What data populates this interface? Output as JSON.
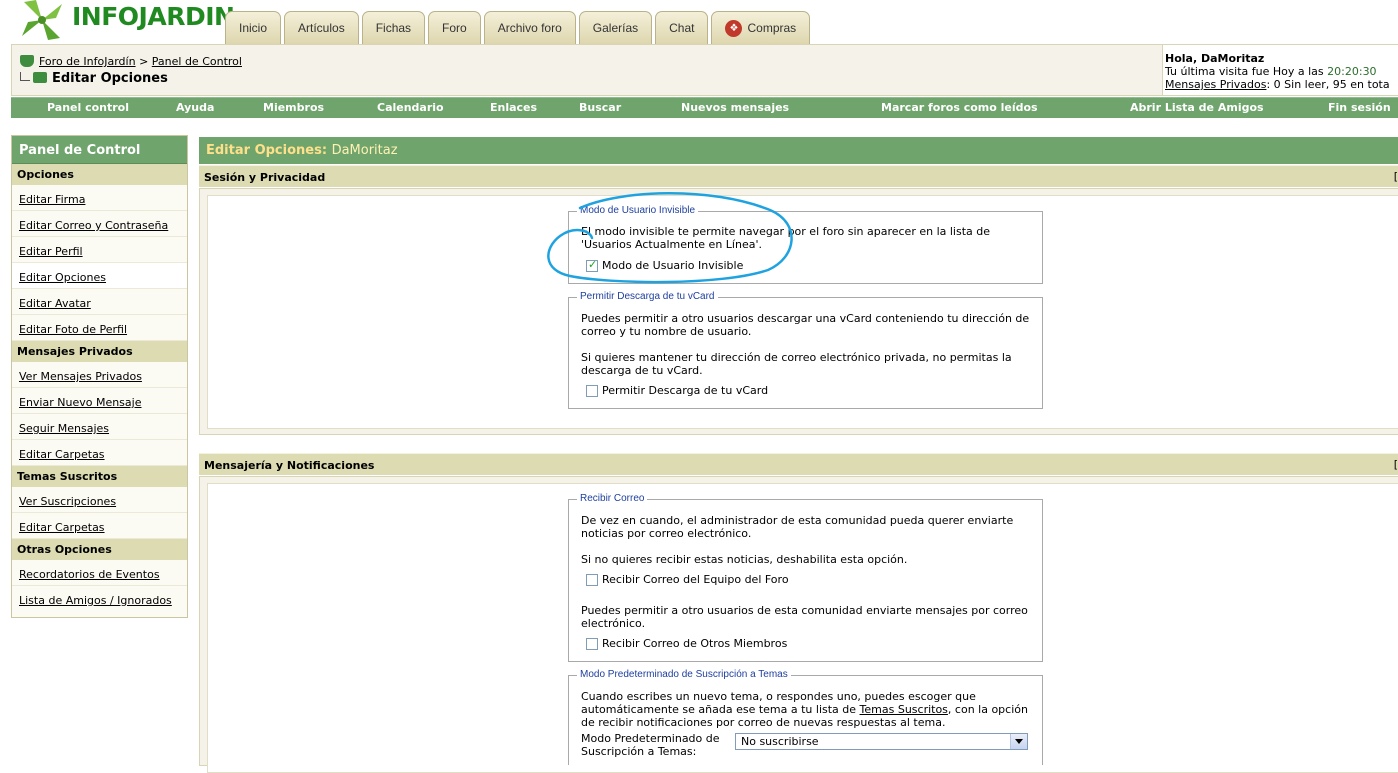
{
  "brand": {
    "logo_text": "INFOJARDIN"
  },
  "tabs": [
    {
      "label": "Inicio"
    },
    {
      "label": "Artículos"
    },
    {
      "label": "Fichas"
    },
    {
      "label": "Foro"
    },
    {
      "label": "Archivo foro"
    },
    {
      "label": "Galerías"
    },
    {
      "label": "Chat"
    },
    {
      "label": "Compras"
    }
  ],
  "breadcrumb": {
    "items": [
      "Foro de InfoJardín",
      "Panel de Control"
    ],
    "separator": ">",
    "current": "Editar Opciones"
  },
  "user": {
    "greeting": "Hola, DaMoritaz",
    "last_visit_prefix": "Tu última visita fue Hoy a las",
    "last_visit_time": "20:20:30",
    "pm_link": "Mensajes Privados",
    "pm_status": ": 0 Sin leer, 95 en tota"
  },
  "navbar": [
    "Panel control",
    "Ayuda",
    "Miembros",
    "Calendario",
    "Enlaces",
    "Buscar",
    "Nuevos mensajes",
    "Marcar foros como leídos",
    "Abrir Lista de Amigos",
    "Fin sesión"
  ],
  "sidebar": {
    "title": "Panel de Control",
    "sections": [
      {
        "title": "Opciones",
        "items": [
          "Editar Firma",
          "Editar Correo y Contraseña",
          "Editar Perfil",
          "Editar Opciones",
          "Editar Avatar",
          "Editar Foto de Perfil"
        ]
      },
      {
        "title": "Mensajes Privados",
        "items": [
          "Ver Mensajes Privados",
          "Enviar Nuevo Mensaje",
          "Seguir Mensajes",
          "Editar Carpetas"
        ]
      },
      {
        "title": "Temas Suscritos",
        "items": [
          "Ver Suscripciones",
          "Editar Carpetas"
        ]
      },
      {
        "title": "Otras Opciones",
        "items": [
          "Recordatorios de Eventos",
          "Lista de Amigos / Ignorados"
        ]
      }
    ],
    "active_item": "Editar Opciones"
  },
  "main": {
    "title": "Editar Opciones:",
    "username": "DaMoritaz",
    "section1": {
      "title": "Sesión y Privacidad",
      "toggle": "[",
      "invisible": {
        "legend": "Modo de Usuario Invisible",
        "description": "El modo invisible te permite navegar por el foro sin aparecer en la lista de 'Usuarios Actualmente en Línea'.",
        "checkbox_label": "Modo de Usuario Invisible",
        "checked": true
      },
      "vcard": {
        "legend": "Permitir Descarga de tu vCard",
        "description1": "Puedes permitir a otro usuarios descargar una vCard conteniendo tu dirección de correo y tu nombre de usuario.",
        "description2": "Si quieres mantener tu dirección de correo electrónico privada, no permitas la descarga de tu vCard.",
        "checkbox_label": "Permitir Descarga de tu vCard",
        "checked": false
      }
    },
    "section2": {
      "title": "Mensajería y Notificaciones",
      "toggle": "[",
      "email": {
        "legend": "Recibir Correo",
        "description1": "De vez en cuando, el administrador de esta comunidad pueda querer enviarte noticias por correo electrónico.",
        "description2": "Si no quieres recibir estas noticias, deshabilita esta opción.",
        "checkbox1_label": "Recibir Correo del Equipo del Foro",
        "description3": "Puedes permitir a otro usuarios de esta comunidad enviarte mensajes por correo electrónico.",
        "checkbox2_label": "Recibir Correo de Otros Miembros"
      },
      "subscription": {
        "legend": "Modo Predeterminado de Suscripción a Temas",
        "description_before": "Cuando escribes un nuevo tema, o respondes uno, puedes escoger que automáticamente se añada ese tema a tu lista de",
        "description_link": "Temas Suscritos",
        "description_after": ", con la opción de recibir notificaciones por correo de nuevas respuestas al tema.",
        "field_label": "Modo Predeterminado de Suscripción a Temas:",
        "select_value": "No suscribirse"
      }
    }
  },
  "colors": {
    "green_bar": "#70a46d",
    "section_header": "#dcdbb2",
    "annotation": "#1fa3e0",
    "title_yellow": "#ffe08a"
  }
}
